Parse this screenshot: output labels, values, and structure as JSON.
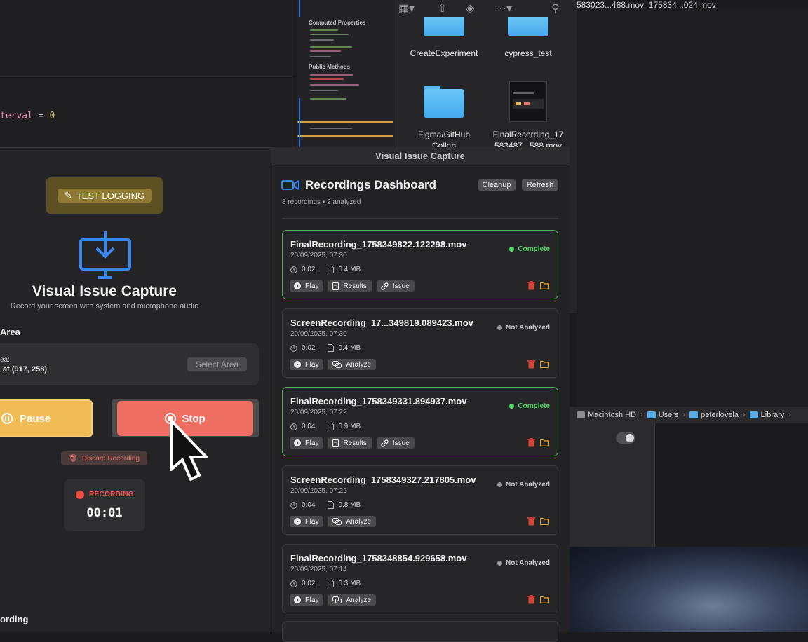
{
  "editor": {
    "code_keyword": "terval",
    "code_rest": " = ",
    "code_number": "0",
    "minimap_sections": [
      "Computed Properties",
      "Public Methods"
    ]
  },
  "finder": {
    "top_files": "583023...488.mov  175834...024.mov",
    "items": [
      {
        "label": "CreateExperiment",
        "icon": "folder-icon"
      },
      {
        "label": "cypress_test",
        "icon": "folder-icon"
      },
      {
        "label": "Figma/GitHub\nCollab",
        "icon": "folder-icon"
      },
      {
        "label": "FinalRecording_17\n583487...588.mov",
        "icon": "video-thumbnail-icon"
      }
    ],
    "path": [
      "Macintosh HD",
      "Users",
      "peterlovela",
      "Library"
    ]
  },
  "capture": {
    "test_logging": "TEST LOGGING",
    "title": "Visual Issue Capture",
    "subtitle": "Record your screen with system and microphone audio",
    "area_heading": "Area",
    "area_label": "ea:",
    "area_value": "at (917, 258)",
    "select_area": "Select Area",
    "pause": "Pause",
    "stop": "Stop",
    "discard": "Discard Recording",
    "recording_label": "RECORDING",
    "timer": "00:01",
    "recording_heading": "ording"
  },
  "dashboard": {
    "window_title": "Visual Issue Capture",
    "title": "Recordings Dashboard",
    "summary": "8 recordings • 2 analyzed",
    "cleanup": "Cleanup",
    "refresh": "Refresh",
    "status_colors": {
      "complete": "#4cd964",
      "not_analyzed": "#9a9aa0"
    },
    "recordings": [
      {
        "name": "FinalRecording_1758349822.122298.mov",
        "date": "20/09/2025, 07:30",
        "duration": "0:02",
        "size": "0.4 MB",
        "status": "Complete",
        "state": "complete",
        "actions": [
          "Play",
          "Results",
          "Issue"
        ]
      },
      {
        "name": "ScreenRecording_17...349819.089423.mov",
        "date": "20/09/2025, 07:30",
        "duration": "0:02",
        "size": "0.4 MB",
        "status": "Not Analyzed",
        "state": "not_analyzed",
        "actions": [
          "Play",
          "Analyze"
        ]
      },
      {
        "name": "FinalRecording_1758349331.894937.mov",
        "date": "20/09/2025, 07:22",
        "duration": "0:04",
        "size": "0.9 MB",
        "status": "Complete",
        "state": "complete",
        "actions": [
          "Play",
          "Results",
          "Issue"
        ]
      },
      {
        "name": "ScreenRecording_1758349327.217805.mov",
        "date": "20/09/2025, 07:22",
        "duration": "0:04",
        "size": "0.8 MB",
        "status": "Not Analyzed",
        "state": "not_analyzed",
        "actions": [
          "Play",
          "Analyze"
        ]
      },
      {
        "name": "FinalRecording_1758348854.929658.mov",
        "date": "20/09/2025, 07:14",
        "duration": "0:02",
        "size": "0.3 MB",
        "status": "Not Analyzed",
        "state": "not_analyzed",
        "actions": [
          "Play",
          "Analyze"
        ]
      }
    ]
  }
}
